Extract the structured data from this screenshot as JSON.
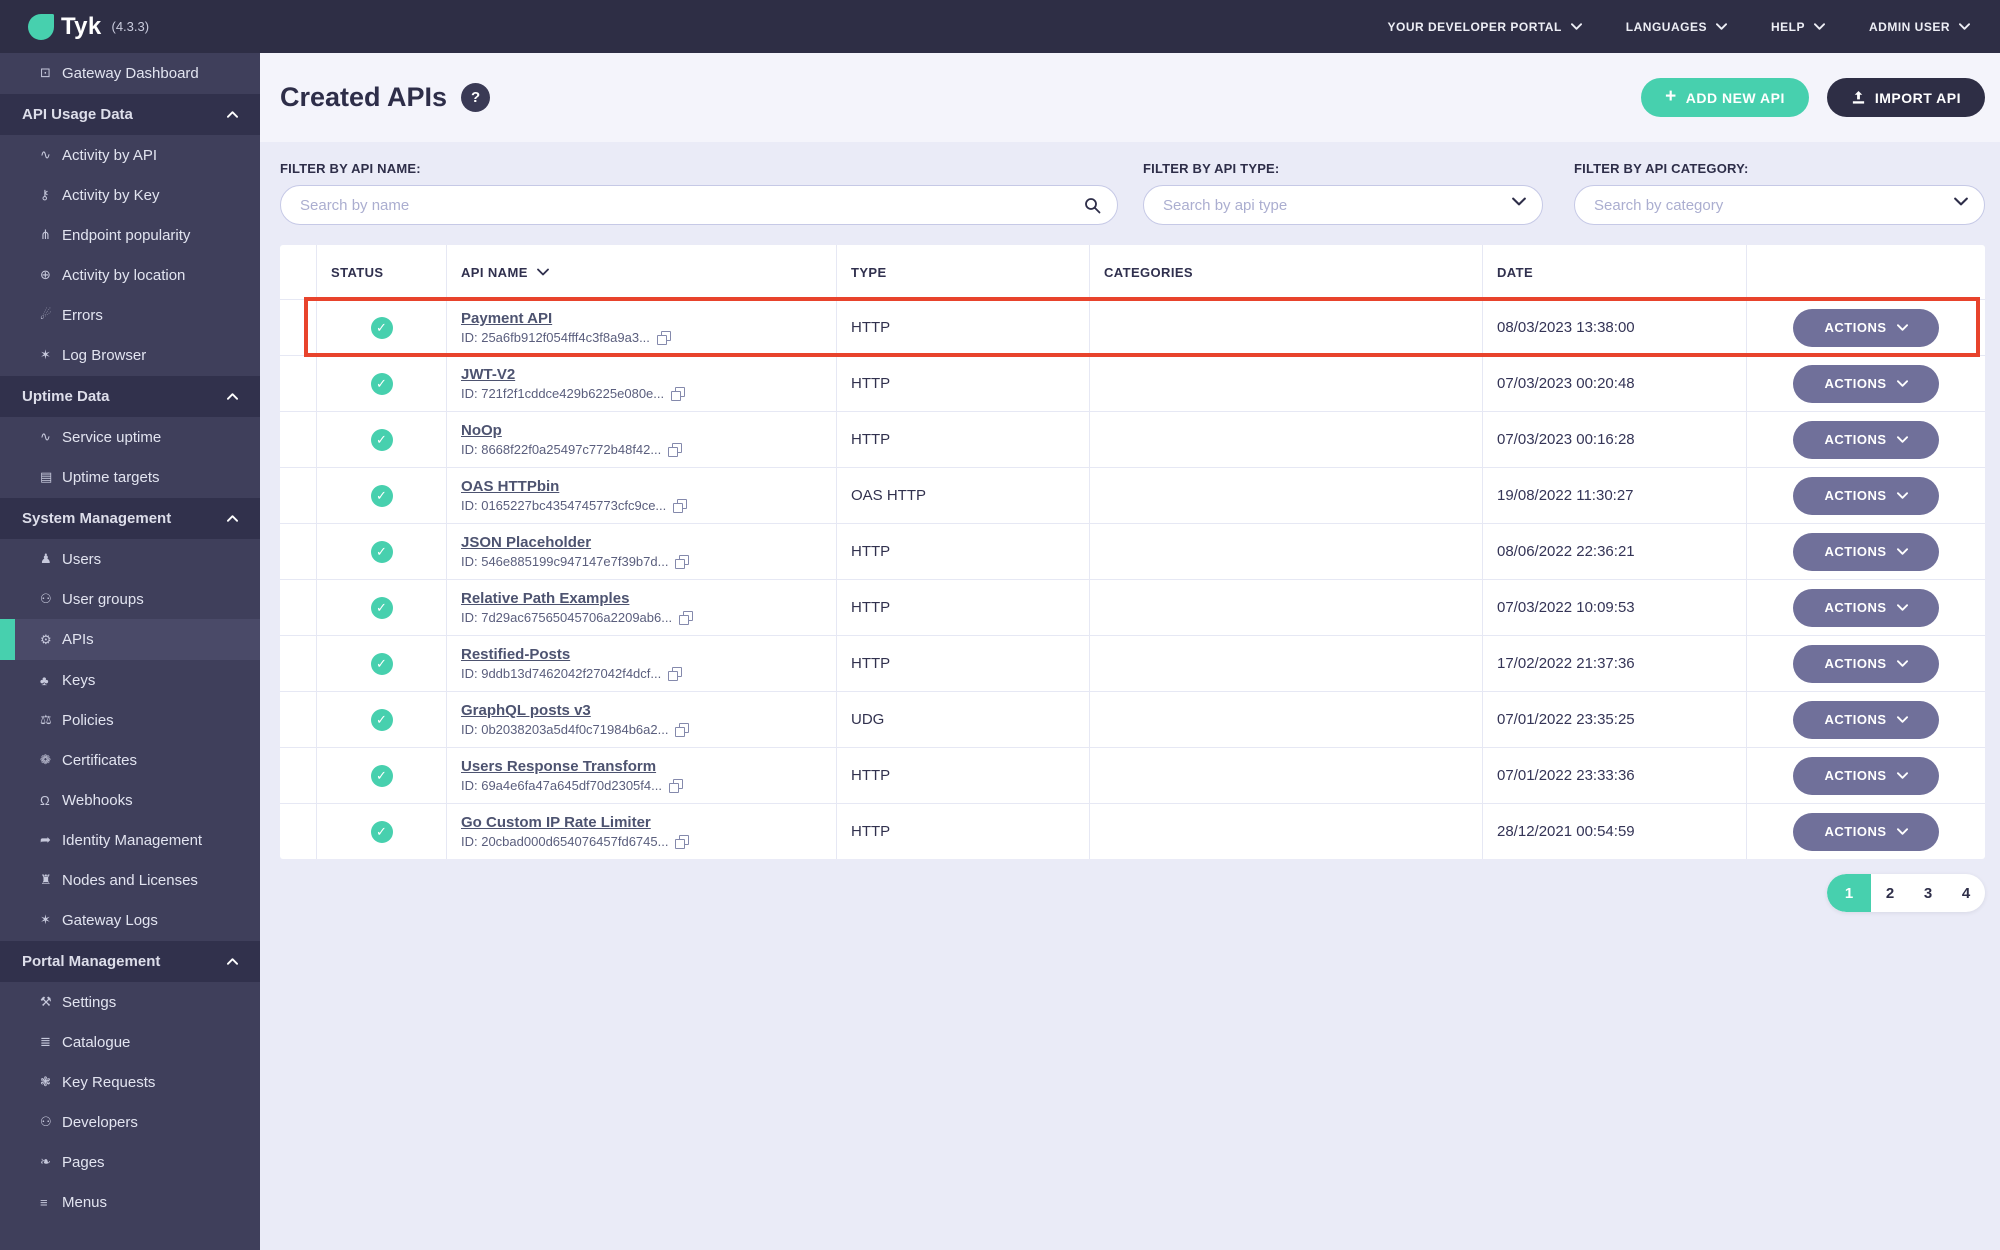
{
  "colors": {
    "accent": "#47D0AE",
    "topbar": "#2E2E45",
    "sidebar": "#3F3F5B",
    "sidebar_section": "#31314C",
    "sidebar_active": "#4A4A68",
    "page_bg": "#EAEBF7",
    "head_bg": "#F4F4FB",
    "row_border": "#E6E8F4",
    "text_dark": "#2E2E49",
    "link": "#4D5370",
    "actions": "#70709A",
    "annotation": "#E8432C"
  },
  "topbar": {
    "logo_text": "Tyk",
    "version": "(4.3.3)",
    "menu": [
      "YOUR DEVELOPER PORTAL",
      "LANGUAGES",
      "HELP",
      "ADMIN USER"
    ]
  },
  "icons": {
    "monitor-icon": "⊡",
    "activity-chart-icon": "∿",
    "key-icon": "⚷",
    "branch-icon": "⋔",
    "globe-icon": "⊕",
    "bomb-icon": "☄",
    "bug-icon": "✶",
    "list-icon": "▤",
    "user-icon": "♟",
    "users-icon": "⚇",
    "gears-icon": "⚙",
    "sitemap-icon": "♣",
    "policy-icon": "⚖",
    "certificate-icon": "❁",
    "bell-icon": "Ω",
    "identity-icon": "➦",
    "building-icon": "♜",
    "wrench-icon": "⚒",
    "catalogue-icon": "≣",
    "key-requests-icon": "❃",
    "leaf-icon": "❧",
    "menu-icon": "≡"
  },
  "sidebar": {
    "items": [
      {
        "kind": "link",
        "label": "Gateway Dashboard",
        "icon": "monitor-icon"
      },
      {
        "kind": "section",
        "label": "API Usage Data"
      },
      {
        "kind": "link",
        "label": "Activity by API",
        "icon": "activity-chart-icon"
      },
      {
        "kind": "link",
        "label": "Activity by Key",
        "icon": "key-icon"
      },
      {
        "kind": "link",
        "label": "Endpoint popularity",
        "icon": "branch-icon"
      },
      {
        "kind": "link",
        "label": "Activity by location",
        "icon": "globe-icon"
      },
      {
        "kind": "link",
        "label": "Errors",
        "icon": "bomb-icon"
      },
      {
        "kind": "link",
        "label": "Log Browser",
        "icon": "bug-icon"
      },
      {
        "kind": "section",
        "label": "Uptime Data"
      },
      {
        "kind": "link",
        "label": "Service uptime",
        "icon": "activity-chart-icon"
      },
      {
        "kind": "link",
        "label": "Uptime targets",
        "icon": "list-icon"
      },
      {
        "kind": "section",
        "label": "System Management"
      },
      {
        "kind": "link",
        "label": "Users",
        "icon": "user-icon"
      },
      {
        "kind": "link",
        "label": "User groups",
        "icon": "users-icon"
      },
      {
        "kind": "link",
        "label": "APIs",
        "icon": "gears-icon",
        "active": true
      },
      {
        "kind": "link",
        "label": "Keys",
        "icon": "sitemap-icon"
      },
      {
        "kind": "link",
        "label": "Policies",
        "icon": "policy-icon"
      },
      {
        "kind": "link",
        "label": "Certificates",
        "icon": "certificate-icon"
      },
      {
        "kind": "link",
        "label": "Webhooks",
        "icon": "bell-icon"
      },
      {
        "kind": "link",
        "label": "Identity Management",
        "icon": "identity-icon"
      },
      {
        "kind": "link",
        "label": "Nodes and Licenses",
        "icon": "building-icon"
      },
      {
        "kind": "link",
        "label": "Gateway Logs",
        "icon": "bug-icon"
      },
      {
        "kind": "section",
        "label": "Portal Management"
      },
      {
        "kind": "link",
        "label": "Settings",
        "icon": "wrench-icon"
      },
      {
        "kind": "link",
        "label": "Catalogue",
        "icon": "catalogue-icon"
      },
      {
        "kind": "link",
        "label": "Key Requests",
        "icon": "key-requests-icon"
      },
      {
        "kind": "link",
        "label": "Developers",
        "icon": "users-icon"
      },
      {
        "kind": "link",
        "label": "Pages",
        "icon": "leaf-icon"
      },
      {
        "kind": "link",
        "label": "Menus",
        "icon": "menu-icon"
      }
    ]
  },
  "header": {
    "title": "Created APIs",
    "help_label": "?",
    "add_button": "ADD NEW API",
    "import_button": "IMPORT API"
  },
  "filters": [
    {
      "label": "FILTER BY API NAME:",
      "placeholder": "Search by name"
    },
    {
      "label": "FILTER BY API TYPE:",
      "placeholder": "Search by api type"
    },
    {
      "label": "FILTER BY API CATEGORY:",
      "placeholder": "Search by category"
    }
  ],
  "table": {
    "columns": [
      "STATUS",
      "API NAME",
      "TYPE",
      "CATEGORIES",
      "DATE"
    ],
    "actions_label": "ACTIONS",
    "rows": [
      {
        "name": "Payment API",
        "id": "ID: 25a6fb912f054fff4c3f8a9a3...",
        "type": "HTTP",
        "categories": "",
        "date": "08/03/2023 13:38:00",
        "status": "active",
        "highlighted": true
      },
      {
        "name": "JWT-V2",
        "id": "ID: 721f2f1cddce429b6225e080e...",
        "type": "HTTP",
        "categories": "",
        "date": "07/03/2023 00:20:48",
        "status": "active"
      },
      {
        "name": "NoOp",
        "id": "ID: 8668f22f0a25497c772b48f42...",
        "type": "HTTP",
        "categories": "",
        "date": "07/03/2023 00:16:28",
        "status": "active"
      },
      {
        "name": "OAS HTTPbin",
        "id": "ID: 0165227bc4354745773cfc9ce...",
        "type": "OAS HTTP",
        "categories": "",
        "date": "19/08/2022 11:30:27",
        "status": "active"
      },
      {
        "name": "JSON Placeholder",
        "id": "ID: 546e885199c947147e7f39b7d...",
        "type": "HTTP",
        "categories": "",
        "date": "08/06/2022 22:36:21",
        "status": "active"
      },
      {
        "name": "Relative Path Examples",
        "id": "ID: 7d29ac67565045706a2209ab6...",
        "type": "HTTP",
        "categories": "",
        "date": "07/03/2022 10:09:53",
        "status": "active"
      },
      {
        "name": "Restified-Posts",
        "id": "ID: 9ddb13d7462042f27042f4dcf...",
        "type": "HTTP",
        "categories": "",
        "date": "17/02/2022 21:37:36",
        "status": "active"
      },
      {
        "name": "GraphQL posts v3",
        "id": "ID: 0b2038203a5d4f0c71984b6a2...",
        "type": "UDG",
        "categories": "",
        "date": "07/01/2022 23:35:25",
        "status": "active"
      },
      {
        "name": "Users Response Transform",
        "id": "ID: 69a4e6fa47a645df70d2305f4...",
        "type": "HTTP",
        "categories": "",
        "date": "07/01/2022 23:33:36",
        "status": "active"
      },
      {
        "name": "Go Custom IP Rate Limiter",
        "id": "ID: 20cbad000d654076457fd6745...",
        "type": "HTTP",
        "categories": "",
        "date": "28/12/2021 00:54:59",
        "status": "active"
      }
    ]
  },
  "pagination": {
    "pages": [
      "1",
      "2",
      "3",
      "4"
    ],
    "active": "1"
  }
}
